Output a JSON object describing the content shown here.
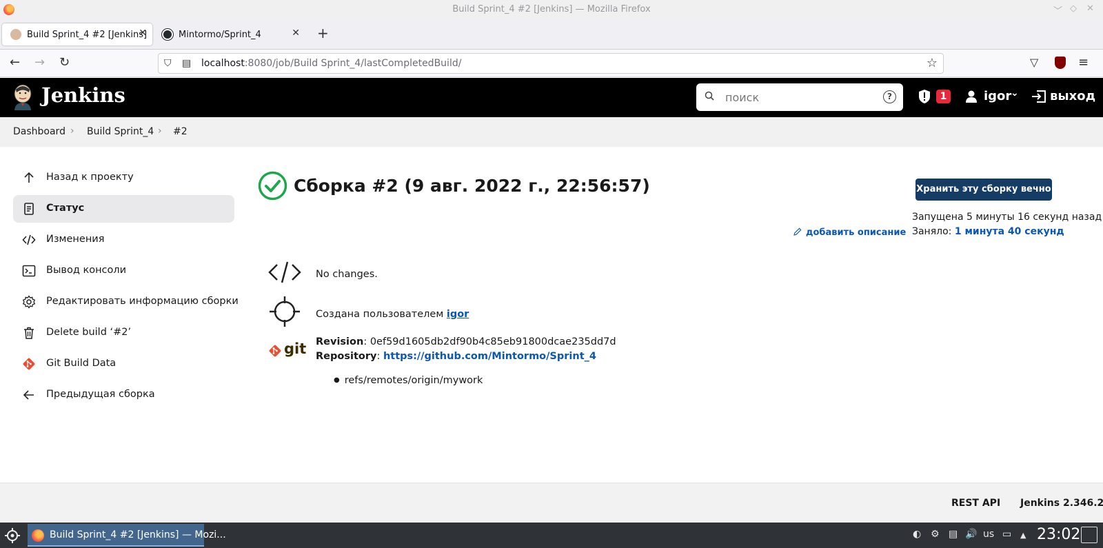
{
  "window": {
    "title": "Build Sprint_4 #2 [Jenkins] — Mozilla Firefox"
  },
  "browser": {
    "tabs": [
      {
        "label": "Build Sprint_4 #2 [Jenkins]",
        "active": true
      },
      {
        "label": "Mintormo/Sprint_4",
        "active": false
      }
    ],
    "url_host": "localhost",
    "url_rest": ":8080/job/Build Sprint_4/lastCompletedBuild/"
  },
  "jenkins": {
    "brand": "Jenkins",
    "search_placeholder": "поиск",
    "security_count": "1",
    "user": "igor",
    "logout": "выход"
  },
  "breadcrumb": [
    "Dashboard",
    "Build Sprint_4",
    "#2"
  ],
  "sidebar": {
    "items": [
      {
        "label": "Назад к проекту",
        "icon": "arrow-up-icon"
      },
      {
        "label": "Статус",
        "icon": "status-document-icon"
      },
      {
        "label": "Изменения",
        "icon": "code-icon"
      },
      {
        "label": "Вывод консоли",
        "icon": "terminal-icon"
      },
      {
        "label": "Редактировать информацию сборки",
        "icon": "gear-icon"
      },
      {
        "label": "Delete build ‘#2’",
        "icon": "trash-icon"
      },
      {
        "label": "Git Build Data",
        "icon": "git-icon"
      },
      {
        "label": "Предыдущая сборка",
        "icon": "arrow-left-icon"
      }
    ]
  },
  "build": {
    "title": "Сборка #2 (9 авг. 2022 г., 22:56:57)",
    "status_color": "#1ea64b",
    "keep_button": "Хранить эту сборку вечно",
    "started": "Запущена 5 минуты 16 секунд назад",
    "took_label": "Заняло:",
    "took_value": "1 минута 40 секунд",
    "add_description": "добавить описание",
    "changes": "No changes.",
    "created_by_label": "Создана пользователем",
    "created_by_user": "igor",
    "git_label": "git",
    "revision_label": "Revision",
    "revision_value": "0ef59d1605db2df90b4c85eb91800dcae235dd7d",
    "repository_label": "Repository",
    "repository_url": "https://github.com/Mintormo/Sprint_4",
    "refs": [
      "refs/remotes/origin/mywork"
    ]
  },
  "footer": {
    "rest_api": "REST API",
    "version": "Jenkins 2.346.2"
  },
  "taskbar": {
    "task_label": "Build Sprint_4 #2 [Jenkins] — Mozi...",
    "keyboard": "us",
    "clock": "23:02"
  },
  "colors": {
    "jenkins_header": "#000000",
    "link": "#0b57b8",
    "primary_button": "#143c64",
    "badge_red": "#e6293b"
  }
}
